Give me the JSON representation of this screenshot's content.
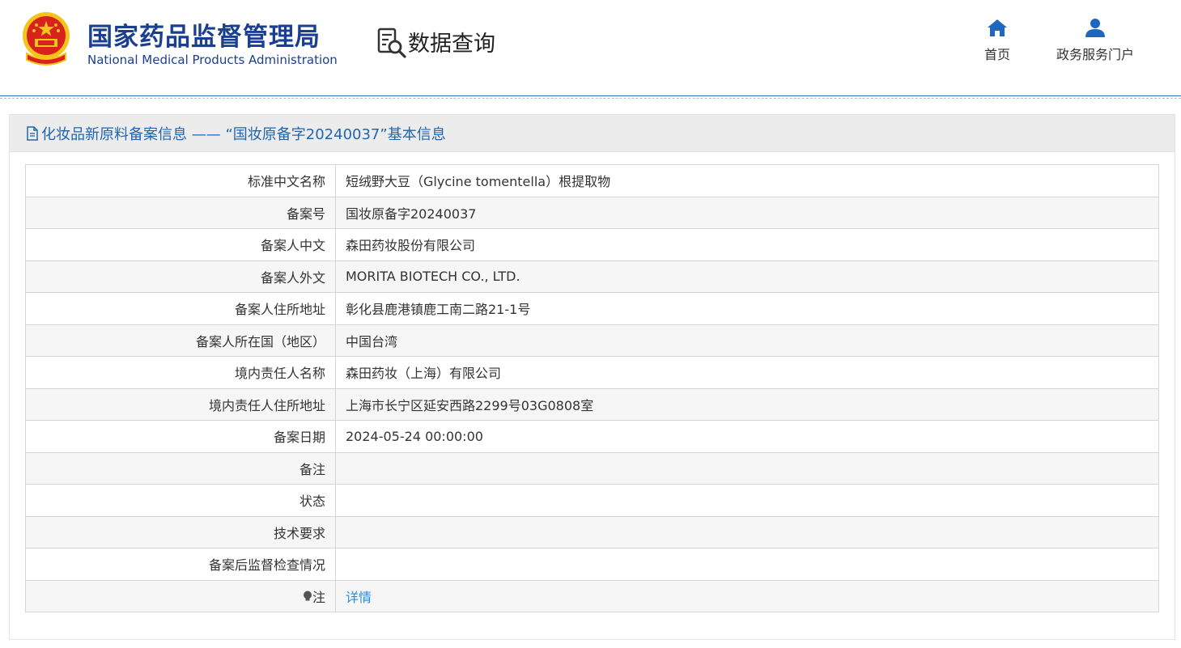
{
  "header": {
    "brand_cn": "国家药品监督管理局",
    "brand_en": "National Medical Products Administration",
    "query_title": "数据查询",
    "nav": [
      {
        "label": "首页",
        "icon": "home-icon"
      },
      {
        "label": "政务服务门户",
        "icon": "user-icon"
      }
    ]
  },
  "panel": {
    "title": "化妆品新原料备案信息 —— “国妆原备字20240037”基本信息",
    "title_icon": "document-icon"
  },
  "rows": [
    {
      "label": "标准中文名称",
      "value": "短绒野大豆（Glycine tomentella）根提取物"
    },
    {
      "label": "备案号",
      "value": "国妆原备字20240037"
    },
    {
      "label": "备案人中文",
      "value": "森田药妆股份有限公司"
    },
    {
      "label": "备案人外文",
      "value": "MORITA BIOTECH CO., LTD."
    },
    {
      "label": "备案人住所地址",
      "value": "彰化县鹿港镇鹿工南二路21-1号"
    },
    {
      "label": "备案人所在国（地区）",
      "value": "中国台湾"
    },
    {
      "label": "境内责任人名称",
      "value": "森田药妆（上海）有限公司"
    },
    {
      "label": "境内责任人住所地址",
      "value": "上海市长宁区延安西路2299号03G0808室"
    },
    {
      "label": "备案日期",
      "value": "2024-05-24 00:00:00"
    },
    {
      "label": "备注",
      "value": ""
    },
    {
      "label": "状态",
      "value": ""
    },
    {
      "label": "技术要求",
      "value": ""
    },
    {
      "label": "备案后监督检查情况",
      "value": ""
    }
  ],
  "note": {
    "label": "注",
    "icon": "bulb-icon",
    "link": "详情"
  },
  "colors": {
    "brand_blue": "#1a3f91",
    "link_blue": "#2f8ad8",
    "title_blue": "#2166b0",
    "emblem_red": "#d7231b",
    "emblem_gold": "#f5c31c"
  }
}
